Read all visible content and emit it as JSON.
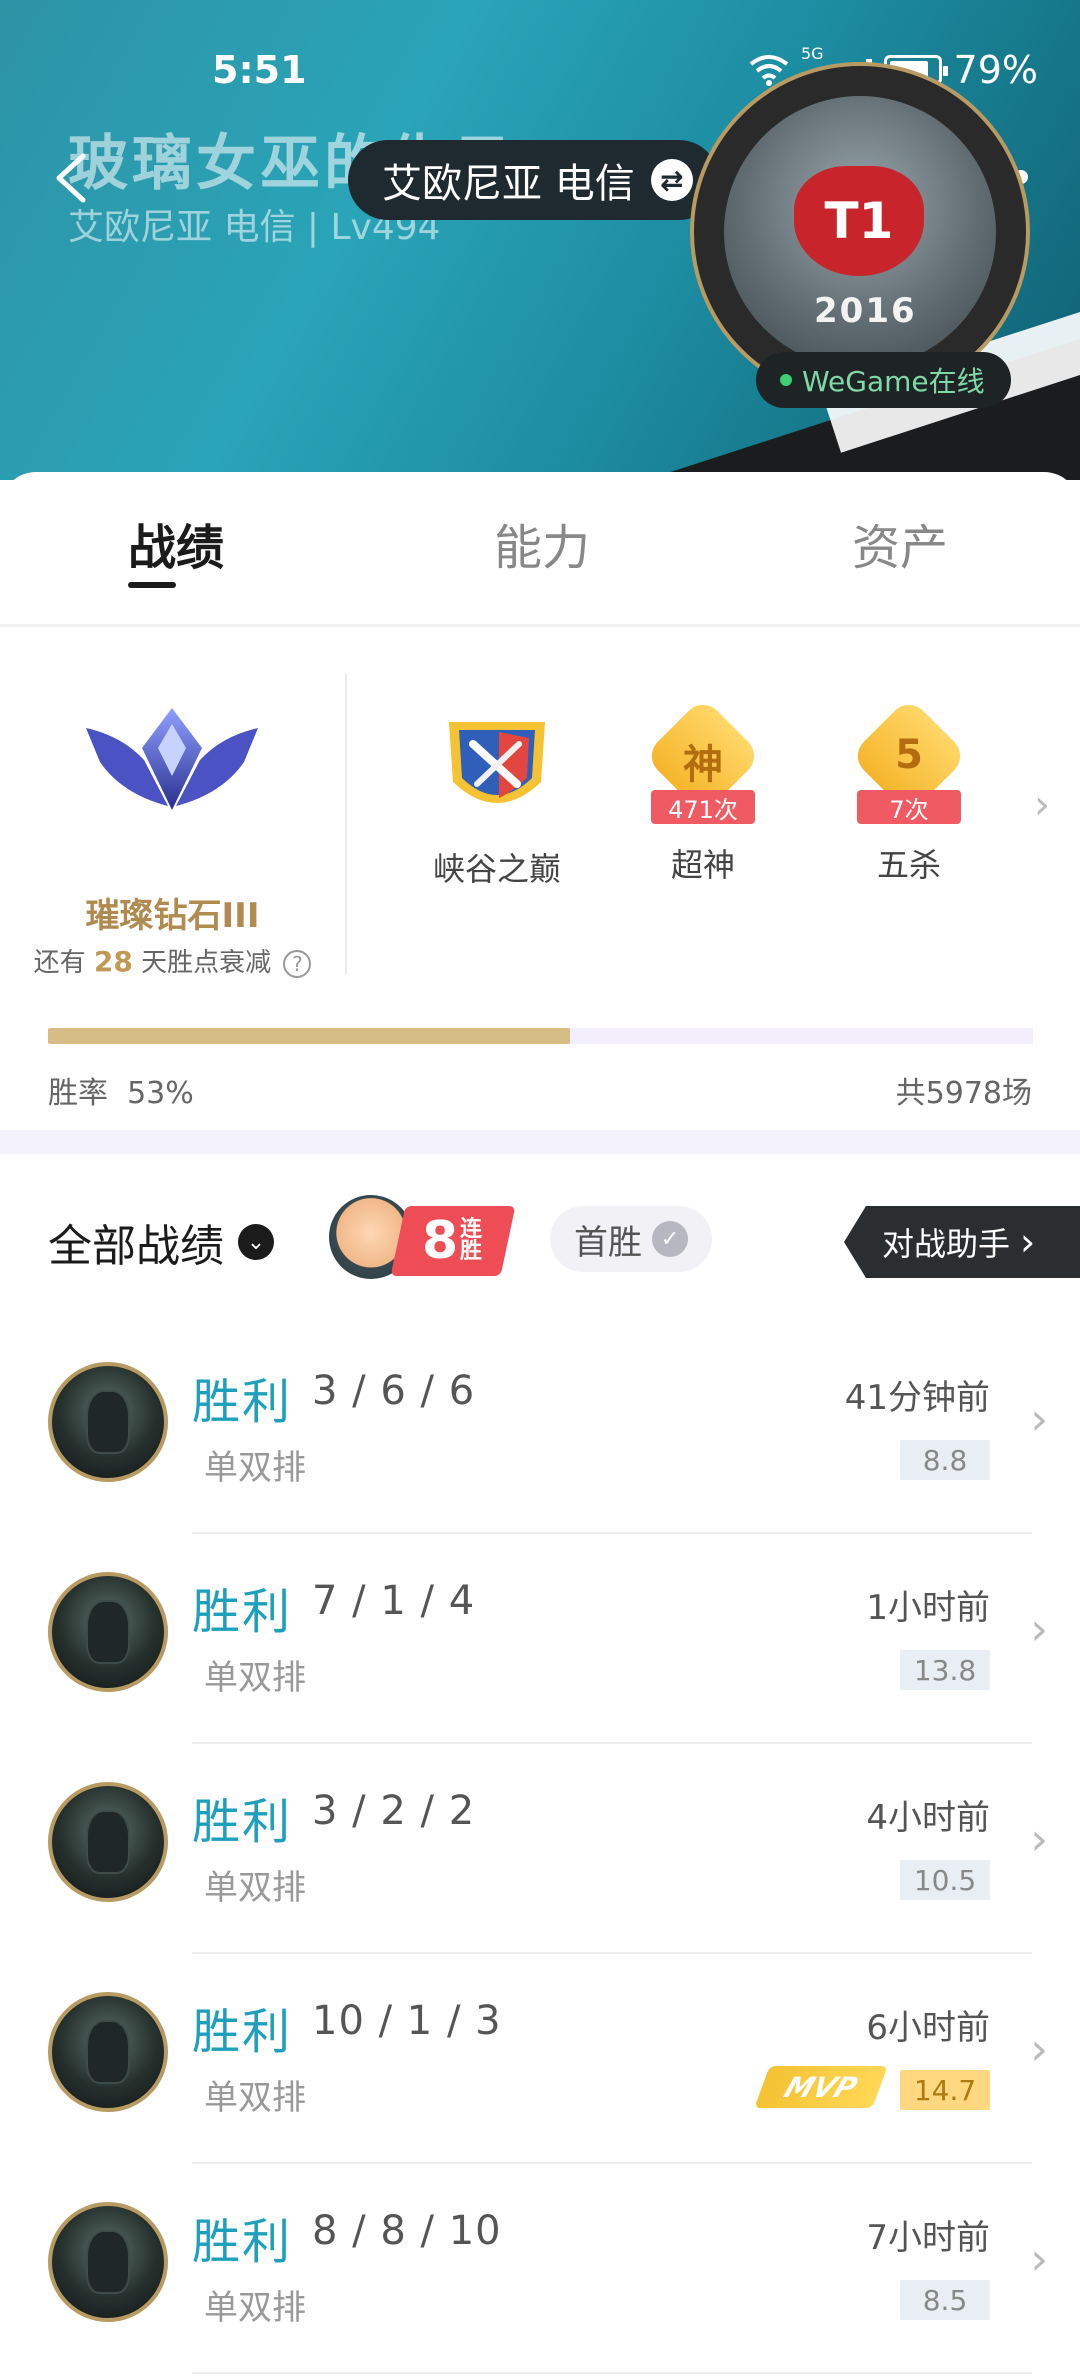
{
  "status": {
    "time": "5:51",
    "net": "5G",
    "battery": "79%"
  },
  "header": {
    "ghost_title": "玻璃女巫的仇日",
    "ghost_sub": "艾欧尼亚 电信 | Lv494",
    "server": "艾欧尼亚 电信",
    "avatar_year": "2016",
    "avatar_logo": "T1",
    "online": "WeGame在线"
  },
  "tabs": [
    "战绩",
    "能力",
    "资产"
  ],
  "rank": {
    "name": "璀璨钻石III",
    "decay_prefix": "还有",
    "decay_days": "28",
    "decay_suffix": "天胜点衰减",
    "badges": [
      {
        "label": "峡谷之巅",
        "icon": "summit-shield-icon"
      },
      {
        "label": "超神",
        "ribbon": "471次",
        "glyph": "神",
        "icon": "legendary-badge-icon"
      },
      {
        "label": "五杀",
        "ribbon": "7次",
        "glyph": "5",
        "icon": "pentakill-badge-icon"
      }
    ],
    "winrate_label": "胜率",
    "winrate": "53%",
    "winrate_value": 0.53,
    "total_games": "共5978场"
  },
  "filters": {
    "all_records": "全部战绩",
    "streak_num": "8",
    "streak_text": "连胜",
    "first_win": "首胜",
    "assistant": "对战助手"
  },
  "matches": [
    {
      "result": "胜利",
      "kda": "3 / 6 / 6",
      "mode": "单双排",
      "time": "41分钟前",
      "score": "8.8",
      "mvp": false
    },
    {
      "result": "胜利",
      "kda": "7 / 1 / 4",
      "mode": "单双排",
      "time": "1小时前",
      "score": "13.8",
      "mvp": false
    },
    {
      "result": "胜利",
      "kda": "3 / 2 / 2",
      "mode": "单双排",
      "time": "4小时前",
      "score": "10.5",
      "mvp": false
    },
    {
      "result": "胜利",
      "kda": "10 / 1 / 3",
      "mode": "单双排",
      "time": "6小时前",
      "score": "14.7",
      "mvp": true,
      "mvp_label": "MVP"
    },
    {
      "result": "胜利",
      "kda": "8 / 8 / 10",
      "mode": "单双排",
      "time": "7小时前",
      "score": "8.5",
      "mvp": false
    }
  ]
}
